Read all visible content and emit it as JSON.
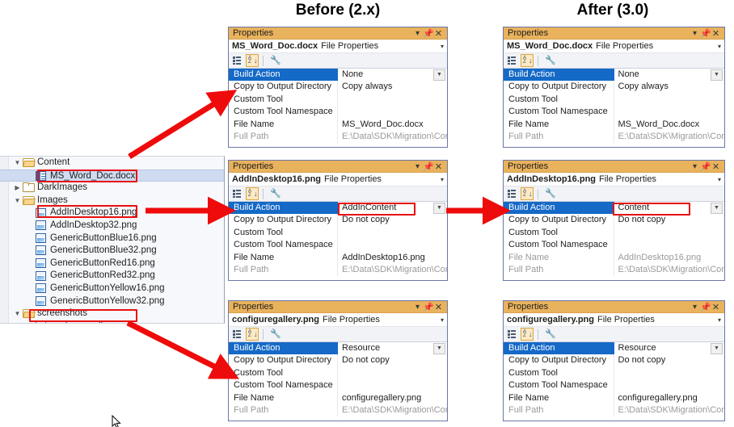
{
  "headers": {
    "before": "Before (2.x)",
    "after": "After (3.0)"
  },
  "tree": {
    "items": [
      {
        "label": "Content",
        "indent": 1,
        "icon": "folder-open-icon",
        "expander": "expanded",
        "selected": false,
        "highlighted": false
      },
      {
        "label": "MS_Word_Doc.docx",
        "indent": 2,
        "icon": "docx-file-icon",
        "expander": "none",
        "selected": true,
        "highlighted": true
      },
      {
        "label": "DarkImages",
        "indent": 1,
        "icon": "folder-closed-icon",
        "expander": "collapsed",
        "selected": false,
        "highlighted": false
      },
      {
        "label": "Images",
        "indent": 1,
        "icon": "folder-open-icon",
        "expander": "expanded",
        "selected": false,
        "highlighted": false
      },
      {
        "label": "AddInDesktop16.png",
        "indent": 2,
        "icon": "png-file-icon",
        "expander": "none",
        "selected": false,
        "highlighted": true
      },
      {
        "label": "AddInDesktop32.png",
        "indent": 2,
        "icon": "png-file-icon",
        "expander": "none",
        "selected": false,
        "highlighted": false
      },
      {
        "label": "GenericButtonBlue16.png",
        "indent": 2,
        "icon": "png-file-icon",
        "expander": "none",
        "selected": false,
        "highlighted": false
      },
      {
        "label": "GenericButtonBlue32.png",
        "indent": 2,
        "icon": "png-file-icon",
        "expander": "none",
        "selected": false,
        "highlighted": false
      },
      {
        "label": "GenericButtonRed16.png",
        "indent": 2,
        "icon": "png-file-icon",
        "expander": "none",
        "selected": false,
        "highlighted": false
      },
      {
        "label": "GenericButtonRed32.png",
        "indent": 2,
        "icon": "png-file-icon",
        "expander": "none",
        "selected": false,
        "highlighted": false
      },
      {
        "label": "GenericButtonYellow16.png",
        "indent": 2,
        "icon": "png-file-icon",
        "expander": "none",
        "selected": false,
        "highlighted": false
      },
      {
        "label": "GenericButtonYellow32.png",
        "indent": 2,
        "icon": "png-file-icon",
        "expander": "none",
        "selected": false,
        "highlighted": false
      },
      {
        "label": "screenshots",
        "indent": 1,
        "icon": "folder-open-icon",
        "expander": "expanded",
        "selected": false,
        "highlighted": false
      },
      {
        "label": "configuregallery.png",
        "indent": 2,
        "icon": "png-file-icon",
        "expander": "none",
        "selected": false,
        "highlighted": true
      }
    ]
  },
  "common": {
    "window_title": "Properties",
    "object_kind": "File Properties",
    "toolbar": {
      "categorized_tooltip": "Categorized",
      "alphabetical_tooltip": "Alphabetical",
      "property_pages_tooltip": "Property Pages"
    },
    "minimize_glyph": "▾",
    "pin_glyph": "⇲",
    "close_glyph": "✕",
    "caret_glyph": "▾",
    "dropdown_glyph": "⌄"
  },
  "panels": [
    {
      "id": "before-docx",
      "object_name": "MS_Word_Doc.docx",
      "rows": [
        {
          "key": "Build Action",
          "value": "None",
          "selected": true,
          "dropdown": true,
          "key_dim": false,
          "value_dim": false,
          "value_boxed": false
        },
        {
          "key": "Copy to Output Directory",
          "value": "Copy always",
          "selected": false,
          "dropdown": false,
          "key_dim": false,
          "value_dim": false,
          "value_boxed": false
        },
        {
          "key": "Custom Tool",
          "value": "",
          "selected": false,
          "dropdown": false,
          "key_dim": false,
          "value_dim": false,
          "value_boxed": false
        },
        {
          "key": "Custom Tool Namespace",
          "value": "",
          "selected": false,
          "dropdown": false,
          "key_dim": false,
          "value_dim": false,
          "value_boxed": false
        },
        {
          "key": "File Name",
          "value": "MS_Word_Doc.docx",
          "selected": false,
          "dropdown": false,
          "key_dim": false,
          "value_dim": false,
          "value_boxed": false
        },
        {
          "key": "Full Path",
          "value": "E:\\Data\\SDK\\Migration\\Configur",
          "selected": false,
          "dropdown": false,
          "key_dim": true,
          "value_dim": true,
          "value_boxed": false
        }
      ]
    },
    {
      "id": "after-docx",
      "object_name": "MS_Word_Doc.docx",
      "rows": [
        {
          "key": "Build Action",
          "value": "None",
          "selected": true,
          "dropdown": true,
          "key_dim": false,
          "value_dim": false,
          "value_boxed": false
        },
        {
          "key": "Copy to Output Directory",
          "value": "Copy always",
          "selected": false,
          "dropdown": false,
          "key_dim": false,
          "value_dim": false,
          "value_boxed": false
        },
        {
          "key": "Custom Tool",
          "value": "",
          "selected": false,
          "dropdown": false,
          "key_dim": false,
          "value_dim": false,
          "value_boxed": false
        },
        {
          "key": "Custom Tool Namespace",
          "value": "",
          "selected": false,
          "dropdown": false,
          "key_dim": false,
          "value_dim": false,
          "value_boxed": false
        },
        {
          "key": "File Name",
          "value": "MS_Word_Doc.docx",
          "selected": false,
          "dropdown": false,
          "key_dim": false,
          "value_dim": false,
          "value_boxed": false
        },
        {
          "key": "Full Path",
          "value": "E:\\Data\\SDK\\Migration\\Configur",
          "selected": false,
          "dropdown": false,
          "key_dim": true,
          "value_dim": true,
          "value_boxed": false
        }
      ]
    },
    {
      "id": "before-png",
      "object_name": "AddInDesktop16.png",
      "rows": [
        {
          "key": "Build Action",
          "value": "AddInContent",
          "selected": true,
          "dropdown": true,
          "key_dim": false,
          "value_dim": false,
          "value_boxed": true
        },
        {
          "key": "Copy to Output Directory",
          "value": "Do not copy",
          "selected": false,
          "dropdown": false,
          "key_dim": false,
          "value_dim": false,
          "value_boxed": false
        },
        {
          "key": "Custom Tool",
          "value": "",
          "selected": false,
          "dropdown": false,
          "key_dim": false,
          "value_dim": false,
          "value_boxed": false
        },
        {
          "key": "Custom Tool Namespace",
          "value": "",
          "selected": false,
          "dropdown": false,
          "key_dim": false,
          "value_dim": false,
          "value_boxed": false
        },
        {
          "key": "File Name",
          "value": "AddInDesktop16.png",
          "selected": false,
          "dropdown": false,
          "key_dim": false,
          "value_dim": false,
          "value_boxed": false
        },
        {
          "key": "Full Path",
          "value": "E:\\Data\\SDK\\Migration\\Configur",
          "selected": false,
          "dropdown": false,
          "key_dim": true,
          "value_dim": true,
          "value_boxed": false
        }
      ]
    },
    {
      "id": "after-png",
      "object_name": "AddInDesktop16.png",
      "rows": [
        {
          "key": "Build Action",
          "value": "Content",
          "selected": true,
          "dropdown": true,
          "key_dim": false,
          "value_dim": false,
          "value_boxed": true
        },
        {
          "key": "Copy to Output Directory",
          "value": "Do not copy",
          "selected": false,
          "dropdown": false,
          "key_dim": false,
          "value_dim": false,
          "value_boxed": false
        },
        {
          "key": "Custom Tool",
          "value": "",
          "selected": false,
          "dropdown": false,
          "key_dim": false,
          "value_dim": false,
          "value_boxed": false
        },
        {
          "key": "Custom Tool Namespace",
          "value": "",
          "selected": false,
          "dropdown": false,
          "key_dim": false,
          "value_dim": false,
          "value_boxed": false
        },
        {
          "key": "File Name",
          "value": "AddInDesktop16.png",
          "selected": false,
          "dropdown": false,
          "key_dim": true,
          "value_dim": true,
          "value_boxed": false
        },
        {
          "key": "Full Path",
          "value": "E:\\Data\\SDK\\Migration\\Configure",
          "selected": false,
          "dropdown": false,
          "key_dim": true,
          "value_dim": true,
          "value_boxed": false
        }
      ]
    },
    {
      "id": "before-gallery",
      "object_name": "configuregallery.png",
      "rows": [
        {
          "key": "Build Action",
          "value": "Resource",
          "selected": true,
          "dropdown": true,
          "key_dim": false,
          "value_dim": false,
          "value_boxed": false
        },
        {
          "key": "Copy to Output Directory",
          "value": "Do not copy",
          "selected": false,
          "dropdown": false,
          "key_dim": false,
          "value_dim": false,
          "value_boxed": false
        },
        {
          "key": "Custom Tool",
          "value": "",
          "selected": false,
          "dropdown": false,
          "key_dim": false,
          "value_dim": false,
          "value_boxed": false
        },
        {
          "key": "Custom Tool Namespace",
          "value": "",
          "selected": false,
          "dropdown": false,
          "key_dim": false,
          "value_dim": false,
          "value_boxed": false
        },
        {
          "key": "File Name",
          "value": "configuregallery.png",
          "selected": false,
          "dropdown": false,
          "key_dim": false,
          "value_dim": false,
          "value_boxed": false
        },
        {
          "key": "Full Path",
          "value": "E:\\Data\\SDK\\Migration\\Configur",
          "selected": false,
          "dropdown": false,
          "key_dim": true,
          "value_dim": true,
          "value_boxed": false
        }
      ]
    },
    {
      "id": "after-gallery",
      "object_name": "configuregallery.png",
      "rows": [
        {
          "key": "Build Action",
          "value": "Resource",
          "selected": true,
          "dropdown": true,
          "key_dim": false,
          "value_dim": false,
          "value_boxed": false
        },
        {
          "key": "Copy to Output Directory",
          "value": "Do not copy",
          "selected": false,
          "dropdown": false,
          "key_dim": false,
          "value_dim": false,
          "value_boxed": false
        },
        {
          "key": "Custom Tool",
          "value": "",
          "selected": false,
          "dropdown": false,
          "key_dim": false,
          "value_dim": false,
          "value_boxed": false
        },
        {
          "key": "Custom Tool Namespace",
          "value": "",
          "selected": false,
          "dropdown": false,
          "key_dim": false,
          "value_dim": false,
          "value_boxed": false
        },
        {
          "key": "File Name",
          "value": "configuregallery.png",
          "selected": false,
          "dropdown": false,
          "key_dim": false,
          "value_dim": false,
          "value_boxed": false
        },
        {
          "key": "Full Path",
          "value": "E:\\Data\\SDK\\Migration\\Configur",
          "selected": false,
          "dropdown": false,
          "key_dim": true,
          "value_dim": true,
          "value_boxed": false
        }
      ]
    }
  ],
  "annotation": {
    "highlight_color": "#e8110f",
    "arrow_color": "#ee0b0b",
    "selection_color": "#1569c7",
    "titlebar_color": "#e9b25c"
  }
}
